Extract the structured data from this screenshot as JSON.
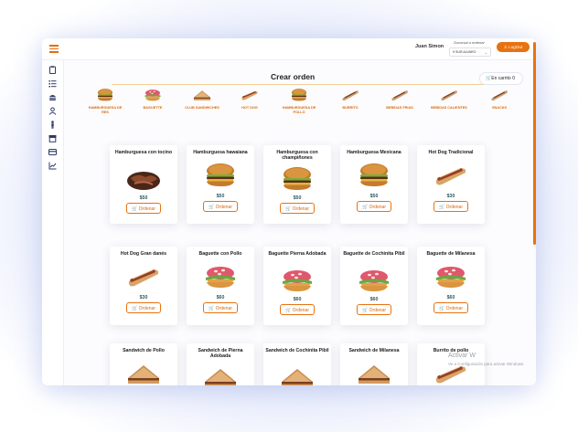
{
  "header": {
    "username": "Juan Simon",
    "branch_label": "Sucursal a ordenar",
    "branch_value": "9 SUR ALVARO",
    "logout_label": "LogOut"
  },
  "page": {
    "title": "Crear orden",
    "cart_label": "En carrito",
    "cart_count": "0"
  },
  "categories": [
    {
      "label": "HAMBURGUESA DE RES",
      "icon": "burger"
    },
    {
      "label": "BAGUETTE",
      "icon": "baguette"
    },
    {
      "label": "CLUB SANDWICHES",
      "icon": "sandwich"
    },
    {
      "label": "HOT DOG",
      "icon": "hotdog"
    },
    {
      "label": "HAMBURGUESA DE POLLO",
      "icon": "burger"
    },
    {
      "label": "BURRITO",
      "icon": "burrito"
    },
    {
      "label": "BEBIDAS FRIAS",
      "icon": "burrito"
    },
    {
      "label": "BEBIDAS CALIENTES",
      "icon": "burrito"
    },
    {
      "label": "SNACKS",
      "icon": "burrito"
    }
  ],
  "products": [
    {
      "name": "Hamburguesa con tocino",
      "price": "$50",
      "icon": "meat",
      "order_label": "Ordenar"
    },
    {
      "name": "Hamburguesa hawaiana",
      "price": "$50",
      "icon": "burger",
      "order_label": "Ordenar"
    },
    {
      "name": "Hamburguesa con champiñones",
      "price": "$50",
      "icon": "burger",
      "order_label": "Ordenar"
    },
    {
      "name": "Hamburguesa Mexicana",
      "price": "$50",
      "icon": "burger",
      "order_label": "Ordenar"
    },
    {
      "name": "Hot Dog Tradicional",
      "price": "$30",
      "icon": "hotdog",
      "order_label": "Ordenar"
    },
    {
      "name": "Hot Dog Gran danés",
      "price": "$30",
      "icon": "hotdog",
      "order_label": "Ordenar"
    },
    {
      "name": "Baguette con Pollo",
      "price": "$60",
      "icon": "baguette",
      "order_label": "Ordenar"
    },
    {
      "name": "Baguette Pierna Adobada",
      "price": "$60",
      "icon": "baguette",
      "order_label": "Ordenar"
    },
    {
      "name": "Baguette de Cochinita Pibil",
      "price": "$60",
      "icon": "baguette",
      "order_label": "Ordenar"
    },
    {
      "name": "Baguette de Milanesa",
      "price": "$60",
      "icon": "baguette",
      "order_label": "Ordenar"
    },
    {
      "name": "Sandwich de Pollo",
      "price": "",
      "icon": "sandwich",
      "order_label": ""
    },
    {
      "name": "Sandwich de Pierna Adobada",
      "price": "",
      "icon": "sandwich",
      "order_label": ""
    },
    {
      "name": "Sandwich de Cochinita Pibil",
      "price": "",
      "icon": "sandwich",
      "order_label": ""
    },
    {
      "name": "Sandwich de Milanesa",
      "price": "",
      "icon": "sandwich",
      "order_label": ""
    },
    {
      "name": "Burrito de pollo",
      "price": "",
      "icon": "hotdog",
      "order_label": ""
    }
  ],
  "sidebar_icons": [
    "clipboard-icon",
    "list-icon",
    "burger-icon",
    "user-icon",
    "person-icon",
    "store-icon",
    "receipt-icon",
    "chart-icon"
  ],
  "watermark": {
    "line1": "Activar W",
    "line2": "Ve a Configuración para activar Windows."
  },
  "colors": {
    "accent": "#e8720f",
    "price": "#2a5a66"
  }
}
